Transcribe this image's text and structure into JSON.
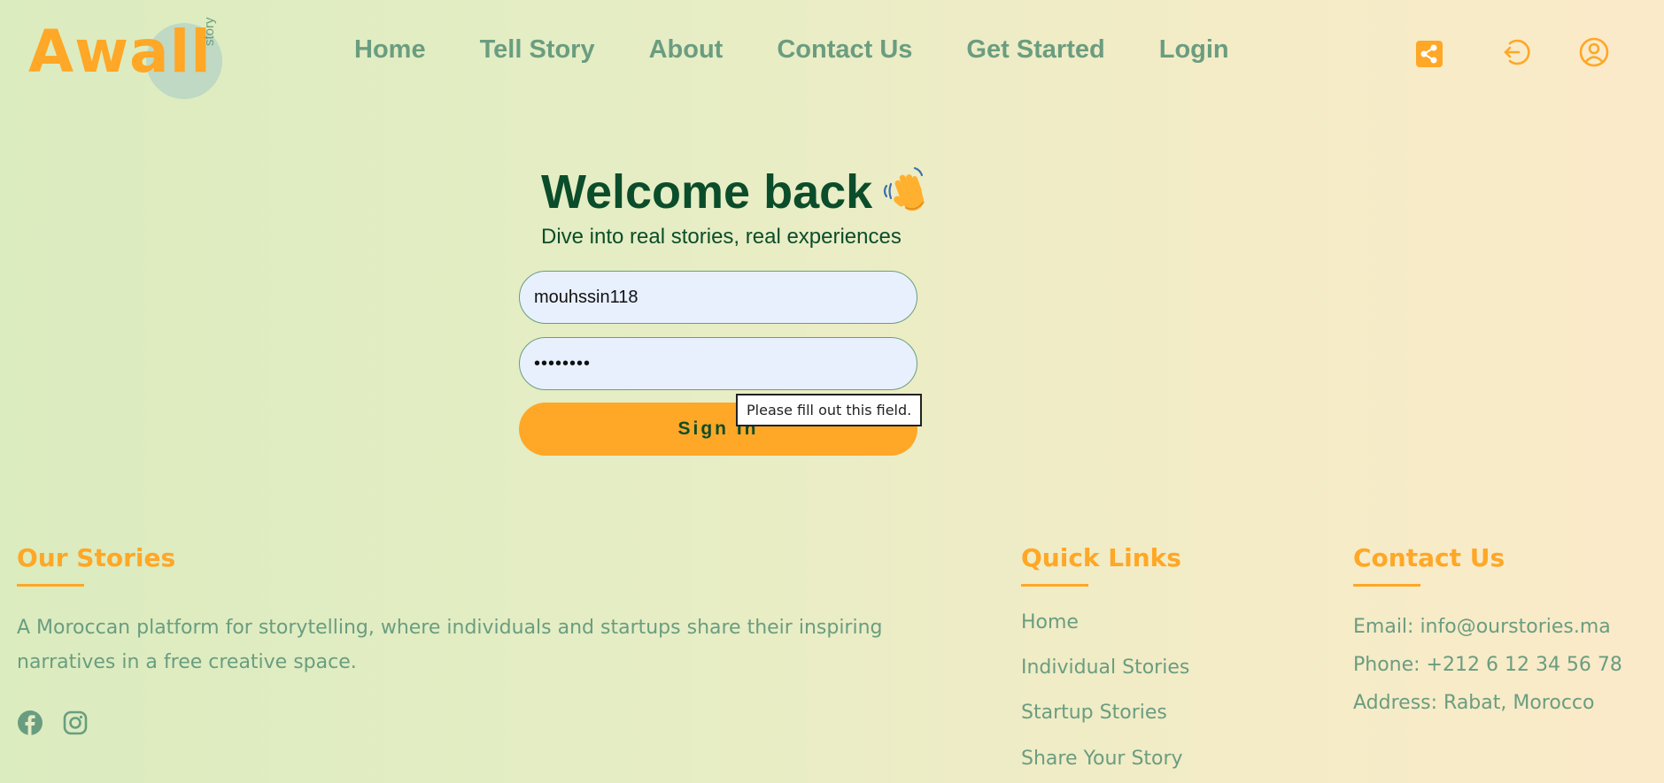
{
  "header": {
    "logo_text": "Awall",
    "logo_subtext": "story",
    "nav": [
      "Home",
      "Tell Story",
      "About",
      "Contact Us",
      "Get Started",
      "Login"
    ],
    "icons": [
      "share-icon",
      "logout-icon",
      "user-icon"
    ]
  },
  "login": {
    "title": "Welcome back",
    "emoji": "waving-hand",
    "subtitle": "Dive into real stories, real experiences",
    "username_value": "mouhssin118",
    "password_masked": "••••••••",
    "signin_label": "Sign In",
    "validation_tooltip": "Please fill out this field."
  },
  "footer": {
    "stories": {
      "heading": "Our Stories",
      "description": "A Moroccan platform for storytelling, where individuals and startups share their inspiring narratives in a free creative space.",
      "social": [
        "facebook-icon",
        "instagram-icon"
      ]
    },
    "quick_links": {
      "heading": "Quick Links",
      "links": [
        "Home",
        "Individual Stories",
        "Startup Stories",
        "Share Your Story"
      ]
    },
    "contact": {
      "heading": "Contact Us",
      "email": "Email: info@ourstories.ma",
      "phone": "Phone: +212 6 12 34 56 78",
      "address": "Address: Rabat, Morocco"
    }
  },
  "colors": {
    "accent": "#ffa726",
    "muted_green": "#6a9d80",
    "dark_green": "#0b4d2b",
    "input_bg": "#e8f0fe"
  }
}
